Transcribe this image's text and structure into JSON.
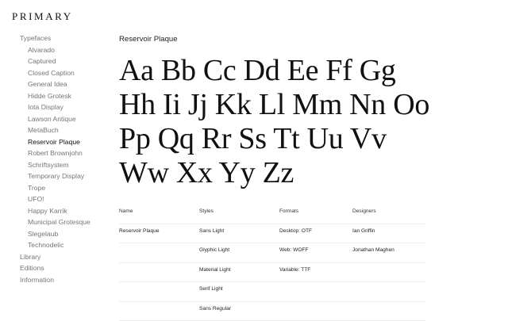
{
  "brand": "PRIMARY",
  "sidebar": {
    "typefaces_label": "Typefaces",
    "typefaces": [
      "Alvarado",
      "Captured",
      "Closed Caption",
      "General Idea",
      "Hidde Grotesk",
      "Iota Display",
      "Lawson Antique",
      "MetaBuch",
      "Reservoir Plaque",
      "Robert Brownjohn",
      "Schriftsystem",
      "Temporary Display",
      "Trope",
      "UFO!",
      "Happy Karrik",
      "Municipal Grotesque",
      "Slegelaub",
      "Technodelic"
    ],
    "active_typeface": "Reservoir Plaque",
    "library": "Library",
    "editions": "Editions",
    "information": "Information"
  },
  "typeface": {
    "title": "Reservoir Plaque",
    "specimen_lines": [
      "Aa Bb Cc Dd Ee Ff Gg",
      "Hh Ii Jj Kk Ll Mm Nn Oo",
      "Pp Qq Rr Ss Tt Uu Vv",
      "Ww Xx Yy Zz"
    ]
  },
  "table": {
    "headers": {
      "name": "Name",
      "styles": "Styles",
      "formats": "Formats",
      "designers": "Designers"
    },
    "rows": [
      {
        "name": "Reservoir Plaque",
        "style": "Sans Light",
        "format": "Desktop: OTF",
        "designer": "Ian Griffin"
      },
      {
        "name": "",
        "style": "Glyphic Light",
        "format": "Web: WOFF",
        "designer": "Jonathan Maghen"
      },
      {
        "name": "",
        "style": "Material Light",
        "format": "Variable: TTF",
        "designer": ""
      },
      {
        "name": "",
        "style": "Serif Light",
        "format": "",
        "designer": ""
      },
      {
        "name": "",
        "style": "Sans Regular",
        "format": "",
        "designer": ""
      }
    ]
  }
}
